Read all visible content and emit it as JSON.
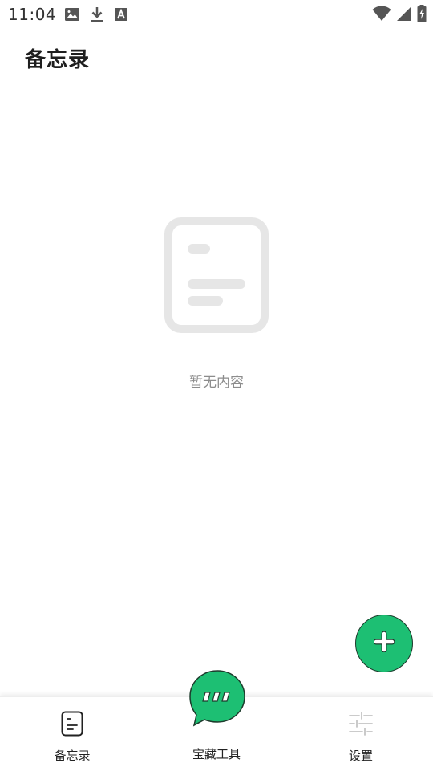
{
  "status_bar": {
    "time": "11:04",
    "left_icons": [
      "image-icon",
      "download-icon",
      "font-icon"
    ],
    "right_icons": [
      "wifi-icon",
      "cellular-signal-icon",
      "battery-charging-icon"
    ]
  },
  "header": {
    "title": "备忘录"
  },
  "empty_state": {
    "icon": "empty-note-icon",
    "text": "暂无内容"
  },
  "fab": {
    "icon": "plus-icon",
    "color": "#1dbf73"
  },
  "bottom_nav": {
    "items": [
      {
        "label": "备忘录",
        "icon": "note-icon",
        "active": true
      },
      {
        "label": "宝藏工具",
        "icon": "chat-bubble-icon",
        "active": false
      },
      {
        "label": "设置",
        "icon": "sliders-icon",
        "active": false
      }
    ]
  },
  "colors": {
    "accent": "#1dbf73",
    "empty_icon": "#e6e6e6",
    "muted_text": "#8c8c8c"
  }
}
